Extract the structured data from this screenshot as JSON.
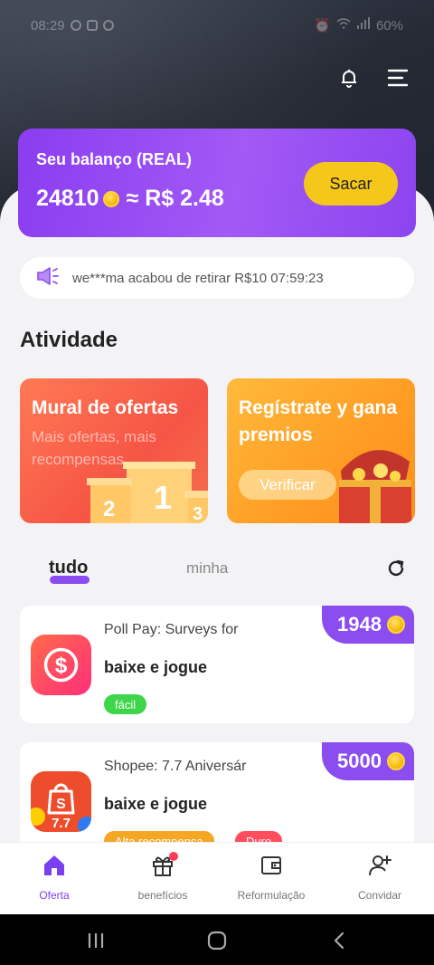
{
  "status_bar": {
    "time": "08:29",
    "battery": "60%"
  },
  "balance": {
    "title": "Seu balanço (REAL)",
    "coins": "24810",
    "approx": "≈ R$ 2.48",
    "withdraw_label": "Sacar"
  },
  "ticker": {
    "message": "we***ma acabou de retirar R$10 07:59:23"
  },
  "activity": {
    "title": "Atividade",
    "promo_left": {
      "title": "Mural de ofertas",
      "subtitle": "Mais ofertas, mais recompensas"
    },
    "promo_right": {
      "title": "Regístrate y gana premios",
      "button": "Verificar"
    }
  },
  "tabs": {
    "all": "tudo",
    "mine": "minha"
  },
  "offers": [
    {
      "name": "Poll Pay: Surveys for",
      "action": "baixe e jogue",
      "reward": "1948",
      "tags": [
        "fácil"
      ],
      "tag_colors": [
        "#3dd64a"
      ]
    },
    {
      "name": "Shopee: 7.7 Aniversár",
      "action": "baixe e jogue",
      "reward": "5000",
      "tags": [
        "Alta recompensa",
        "Duro"
      ],
      "tag_colors": [
        "#f5a623",
        "#ff4d5e"
      ]
    }
  ],
  "bottom_nav": [
    {
      "label": "Oferta",
      "icon": "home-icon",
      "active": true
    },
    {
      "label": "benefícios",
      "icon": "gift-icon",
      "active": false
    },
    {
      "label": "Reformulação",
      "icon": "wallet-icon",
      "active": false
    },
    {
      "label": "Convidar",
      "icon": "add-user-icon",
      "active": false
    }
  ],
  "colors": {
    "accent": "#8b4cf0",
    "coin": "#f5b400",
    "button_yellow": "#f5c71a"
  }
}
